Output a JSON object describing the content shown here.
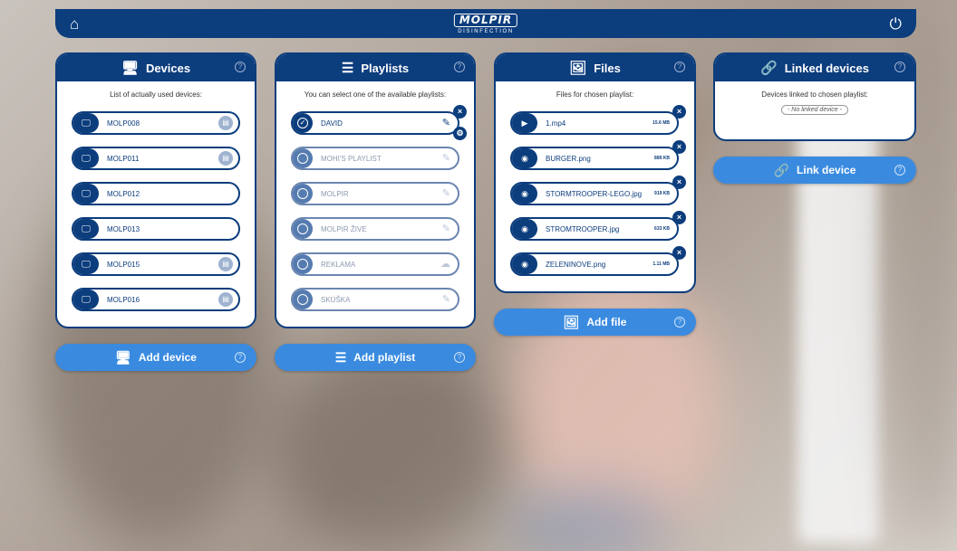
{
  "header": {
    "brand": "MOLPIR",
    "brand_sub": "DISINFECTION",
    "home_icon": "home-icon",
    "power_icon": "power-icon"
  },
  "devices": {
    "title": "Devices",
    "subtitle": "List of actually used devices:",
    "items": [
      {
        "name": "MOLP008",
        "has_chart": true
      },
      {
        "name": "MOLP011",
        "has_chart": true
      },
      {
        "name": "MOLP012",
        "has_chart": false
      },
      {
        "name": "MOLP013",
        "has_chart": false
      },
      {
        "name": "MOLP015",
        "has_chart": true
      },
      {
        "name": "MOLP016",
        "has_chart": true
      }
    ],
    "add_label": "Add device"
  },
  "playlists": {
    "title": "Playlists",
    "subtitle": "You can select one of the available playlists:",
    "items": [
      {
        "name": "DAVID",
        "selected": true
      },
      {
        "name": "MOHI'S PLAYLIST",
        "selected": false
      },
      {
        "name": "MOLPIR",
        "selected": false
      },
      {
        "name": "MOLPIR ŽIVE",
        "selected": false
      },
      {
        "name": "REKLAMA",
        "selected": false
      },
      {
        "name": "SKÚŠKA",
        "selected": false
      }
    ],
    "add_label": "Add playlist"
  },
  "files": {
    "title": "Files",
    "subtitle": "Files for chosen playlist:",
    "items": [
      {
        "name": "1.mp4",
        "size": "15.6 MB",
        "type": "video"
      },
      {
        "name": "BURGER.png",
        "size": "889 KB",
        "type": "image"
      },
      {
        "name": "STORMTROOPER-LEGO.jpg",
        "size": "919 KB",
        "type": "image"
      },
      {
        "name": "STROMTROOPER.jpg",
        "size": "633 KB",
        "type": "image"
      },
      {
        "name": "ZELENINOVE.png",
        "size": "1.11 MB",
        "type": "image"
      }
    ],
    "add_label": "Add file"
  },
  "linked": {
    "title": "Linked devices",
    "subtitle": "Devices linked to chosen playlist:",
    "empty_label": "- No linked device -",
    "link_label": "Link device"
  },
  "help_glyph": "?",
  "close_glyph": "×",
  "colors": {
    "navy": "#0c3d7d",
    "accent": "#3a8be0"
  }
}
